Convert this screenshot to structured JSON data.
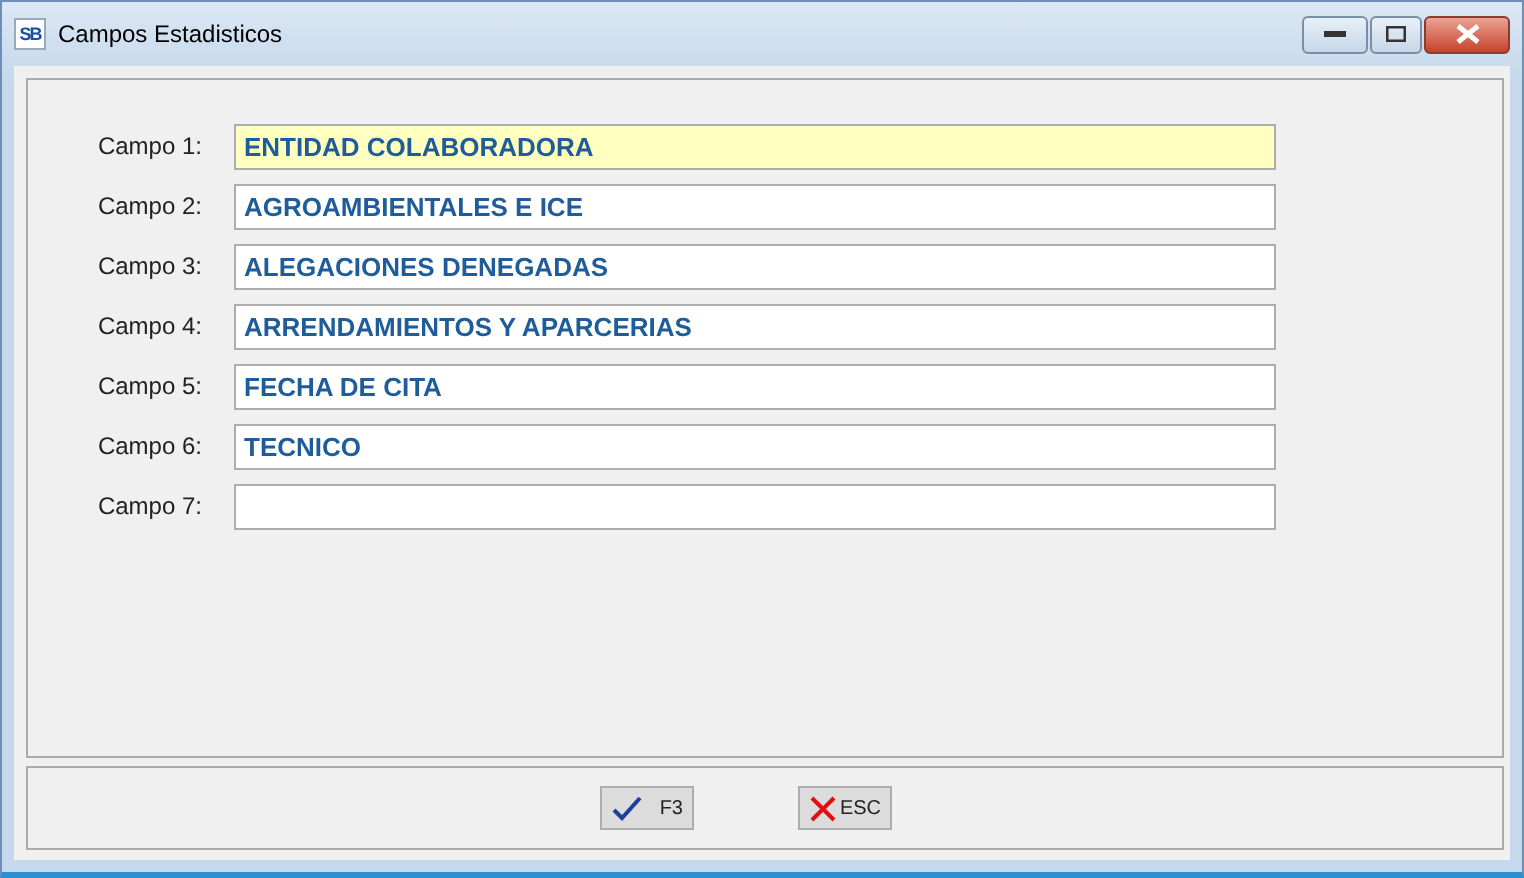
{
  "window": {
    "title": "Campos Estadisticos",
    "app_icon": "SB"
  },
  "fields": [
    {
      "label": "Campo 1:",
      "value": "ENTIDAD COLABORADORA",
      "focused": true
    },
    {
      "label": "Campo 2:",
      "value": "AGROAMBIENTALES E ICE",
      "focused": false
    },
    {
      "label": "Campo 3:",
      "value": "ALEGACIONES DENEGADAS",
      "focused": false
    },
    {
      "label": "Campo 4:",
      "value": "ARRENDAMIENTOS Y APARCERIAS",
      "focused": false
    },
    {
      "label": "Campo 5:",
      "value": "FECHA DE CITA",
      "focused": false
    },
    {
      "label": "Campo 6:",
      "value": "TECNICO",
      "focused": false
    },
    {
      "label": "Campo 7:",
      "focused": false
    }
  ],
  "buttons": [
    {
      "kind": "accept",
      "label": "F3"
    },
    {
      "kind": "cancel",
      "label": "ESC"
    }
  ]
}
